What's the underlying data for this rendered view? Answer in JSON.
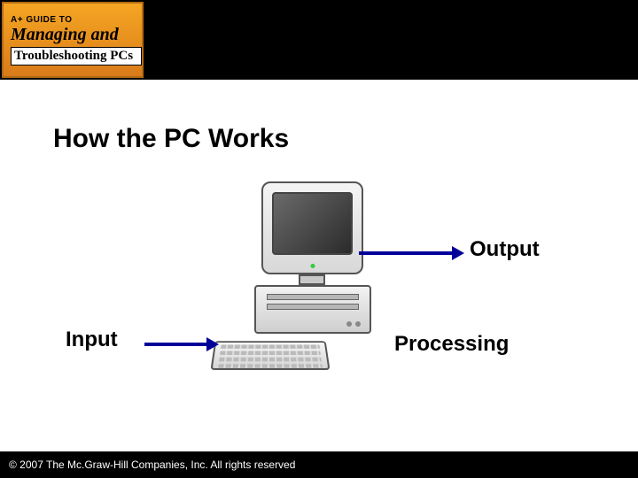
{
  "logo": {
    "tag": "A+ GUIDE TO",
    "line1": "Managing and",
    "line2": "Troubleshooting PCs"
  },
  "title": "How the PC Works",
  "labels": {
    "output": "Output",
    "input": "Input",
    "processing": "Processing"
  },
  "footer": "© 2007 The Mc.Graw-Hill Companies, Inc. All rights reserved"
}
